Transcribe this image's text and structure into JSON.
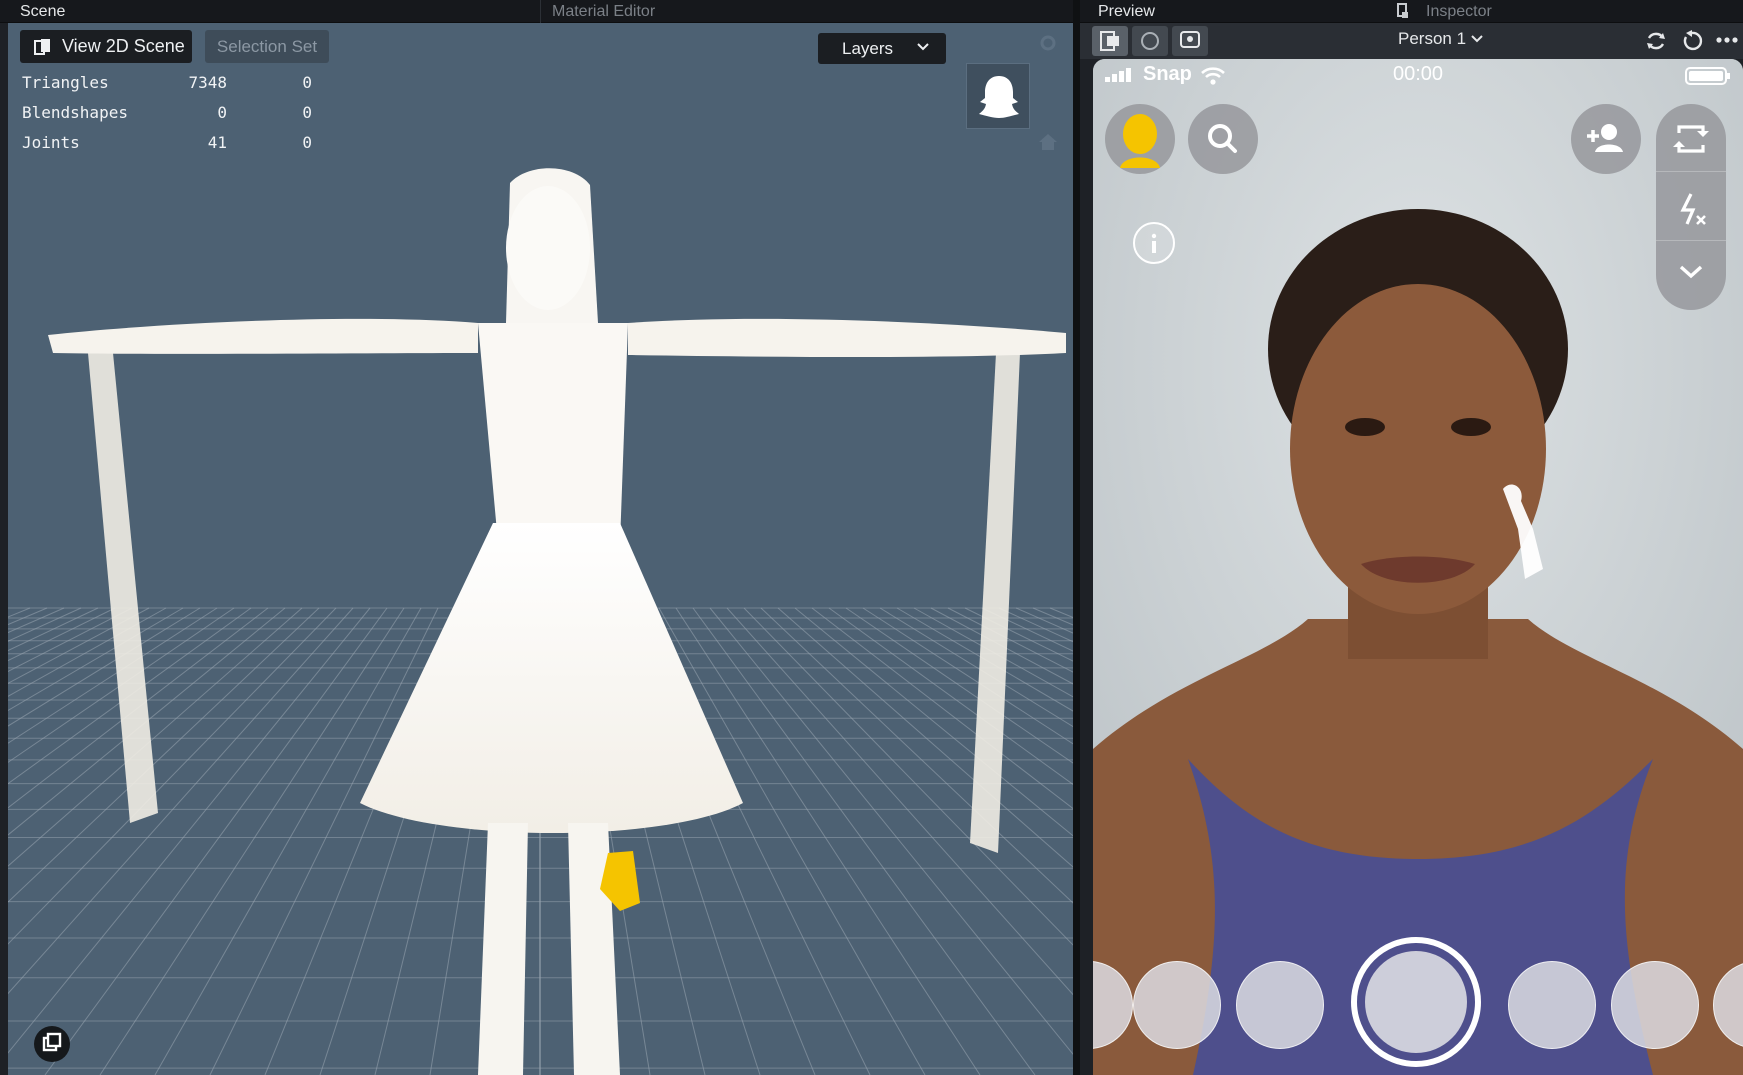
{
  "scene_panel": {
    "tabs": [
      {
        "label": "Scene",
        "active": true
      },
      {
        "label": "Material Editor",
        "active": false
      }
    ],
    "view_2d_label": "View 2D Scene",
    "selection_set_label": "Selection Set",
    "layers_label": "Layers",
    "stats": [
      {
        "label": "Triangles",
        "value": "7348",
        "selected": "0"
      },
      {
        "label": "Blendshapes",
        "value": "0",
        "selected": "0"
      },
      {
        "label": "Joints",
        "value": "41",
        "selected": "0"
      }
    ]
  },
  "preview_panel": {
    "tabs": [
      {
        "label": "Preview",
        "active": true
      },
      {
        "label": "Inspector",
        "active": false
      }
    ],
    "person_select": "Person 1",
    "phone": {
      "carrier": "Snap",
      "clock": "00:00"
    }
  },
  "colors": {
    "viewport_bg": "#4d6173",
    "panel_bg": "#1e2126",
    "accent_yellow": "#f5c400",
    "grid_line": "#9aa6b2"
  }
}
